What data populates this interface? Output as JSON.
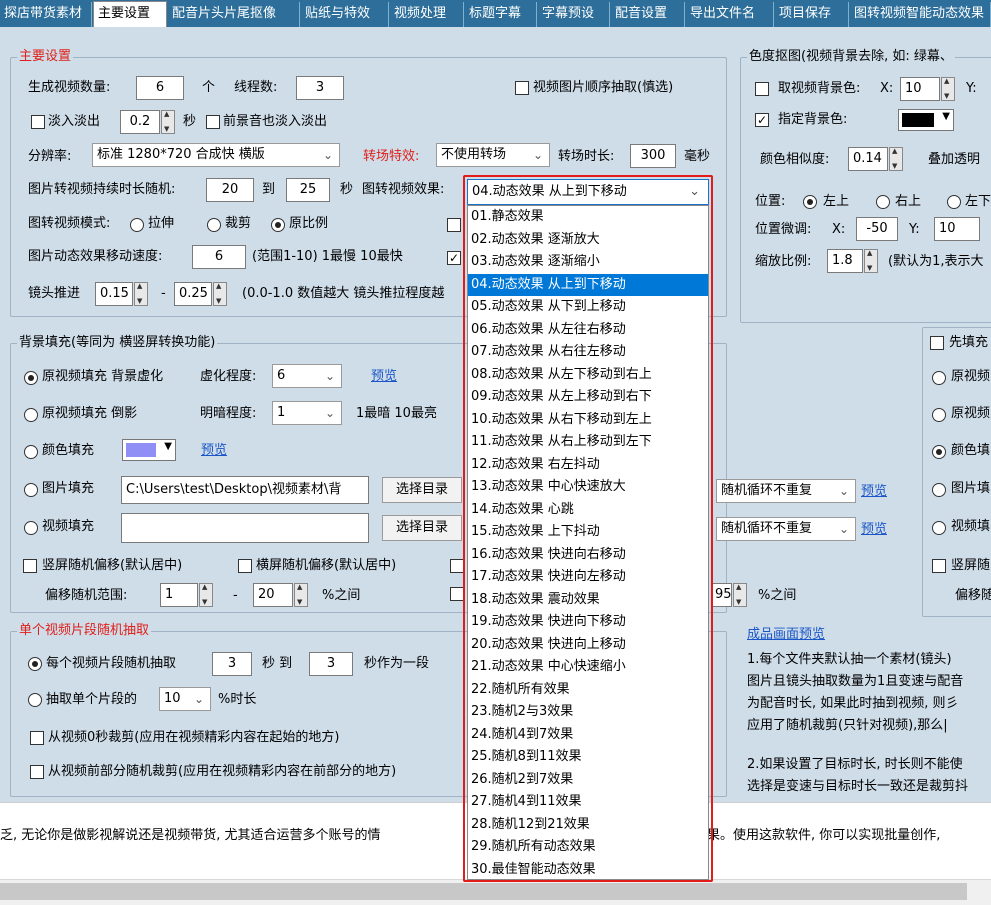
{
  "tabs": [
    "探店带货素材",
    "主要设置",
    "配音片头片尾抠像",
    "贴纸与特效",
    "视频处理",
    "标题字幕",
    "字幕预设",
    "配音设置",
    "导出文件名",
    "项目保存",
    "图转视频智能动态效果"
  ],
  "main": {
    "title": "主要设置",
    "count_label": "生成视频数量:",
    "count_value": "6",
    "count_unit": "个",
    "threads_label": "线程数:",
    "threads_value": "3",
    "seq_label": "视频图片顺序抽取(慎选)",
    "fade_label": "淡入淡出",
    "fade_value": "0.2",
    "fade_unit": "秒",
    "bgm_fade_label": "前景音也淡入淡出",
    "res_label": "分辨率:",
    "res_value": "标准 1280*720 合成快 横版",
    "trans_label": "转场特效:",
    "trans_value": "不使用转场",
    "trans_dur_label": "转场时长:",
    "trans_dur_value": "300",
    "trans_dur_unit": "毫秒",
    "img_dur_label": "图片转视频持续时长随机:",
    "img_dur_min": "20",
    "img_dur_to": "到",
    "img_dur_max": "25",
    "img_dur_unit": "秒",
    "img_effect_label": "图转视频效果:",
    "mode_label": "图转视频模式:",
    "mode_stretch": "拉伸",
    "mode_crop": "裁剪",
    "mode_ratio": "原比例",
    "speed_label": "图片动态效果移动速度:",
    "speed_value": "6",
    "speed_hint": "(范围1-10) 1最慢 10最快",
    "push_label": "镜头推进",
    "push_min": "0.15",
    "push_dash": "-",
    "push_max": "0.25",
    "push_hint": "(0.0-1.0 数值越大 镜头推拉程度越"
  },
  "effect_dropdown": {
    "selected": "04.动态效果 从上到下移动",
    "options": [
      "01.静态效果",
      "02.动态效果 逐渐放大",
      "03.动态效果 逐渐缩小",
      "04.动态效果 从上到下移动",
      "05.动态效果 从下到上移动",
      "06.动态效果 从左往右移动",
      "07.动态效果 从右往左移动",
      "08.动态效果 从左下移动到右上",
      "09.动态效果 从左上移动到右下",
      "10.动态效果 从右下移动到左上",
      "11.动态效果 从右上移动到左下",
      "12.动态效果 右左抖动",
      "13.动态效果 中心快速放大",
      "14.动态效果 心跳",
      "15.动态效果 上下抖动",
      "16.动态效果 快进向右移动",
      "17.动态效果 快进向左移动",
      "18.动态效果 震动效果",
      "19.动态效果 快进向下移动",
      "20.动态效果 快进向上移动",
      "21.动态效果 中心快速缩小",
      "22.随机所有效果",
      "23.随机2与3效果",
      "24.随机4到7效果",
      "25.随机8到11效果",
      "26.随机2到7效果",
      "27.随机4到11效果",
      "28.随机12到21效果",
      "29.随机所有动态效果",
      "30.最佳智能动态效果"
    ]
  },
  "chroma": {
    "title": "色度抠图(视频背景去除, 如: 绿幕、",
    "take_bg_label": "取视频背景色:",
    "x_label": "X:",
    "x_value": "10",
    "y_label": "Y:",
    "assign_label": "指定背景色:",
    "similar_label": "颜色相似度:",
    "similar_value": "0.14",
    "overlay_label": "叠加透明",
    "pos_label": "位置:",
    "pos_tl": "左上",
    "pos_tr": "右上",
    "pos_bl": "左下",
    "fine_label": "位置微调:",
    "fine_x_label": "X:",
    "fine_x": "-50",
    "fine_y_label": "Y:",
    "fine_y": "10",
    "scale_label": "缩放比例:",
    "scale_value": "1.8",
    "scale_hint": "(默认为1,表示大"
  },
  "bgfill": {
    "title": "背景填充(等同为 横竖屏转换功能)",
    "orig_blur": "原视频填充 背景虚化",
    "blur_label": "虚化程度:",
    "blur_value": "6",
    "preview": "预览",
    "orig_reflect": "原视频填充 倒影",
    "bright_label": "明暗程度:",
    "bright_value": "1",
    "bright_hint": "1最暗 10最亮",
    "color_fill": "颜色填充",
    "color_preview": "预览",
    "image_fill": "图片填充",
    "image_path": "C:\\Users\\test\\Desktop\\视频素材\\背",
    "choose_dir": "选择目录",
    "video_fill": "视频填充",
    "choose_dir2": "选择目录",
    "loop1": "随机循环不重复",
    "loop2": "随机循环不重复",
    "preview2": "预览",
    "preview3": "预览",
    "v_offset": "竖屏随机偏移(默认居中)",
    "h_offset": "横屏随机偏移(默认居中)",
    "range_label": "偏移随机范围:",
    "range_min": "1",
    "range_dash": "-",
    "range_max": "20",
    "range_unit": "%之间",
    "range_right_value": "95",
    "range_right_unit": "%之间"
  },
  "right_fill": {
    "prefill": "先填充",
    "o1": "原视频",
    "o2": "原视频",
    "o3": "颜色填",
    "o4": "图片填",
    "o5": "视频填",
    "o6": "竖屏随",
    "offset": "偏移随"
  },
  "segment": {
    "title": "单个视频片段随机抽取",
    "each_label": "每个视频片段随机抽取",
    "each_min": "3",
    "each_to": "秒 到",
    "each_max": "3",
    "each_unit": "秒作为一段",
    "single_label": "抽取单个片段的",
    "single_value": "10",
    "single_unit": "%时长",
    "from0": "从视频0秒裁剪(应用在视频精彩内容在起始的地方)",
    "from_front": "从视频前部分随机裁剪(应用在视频精彩内容在前部分的地方)"
  },
  "preview_panel": {
    "link": "成品画面预览",
    "l1": "1.每个文件夹默认抽一个素材(镜头)",
    "l2": "图片且镜头抽取数量为1且变速与配音",
    "l3": "为配音时长, 如果此时抽到视频, 则彡",
    "l4": "应用了随机裁剪(只针对视频),那么|",
    "l5": "2.如果设置了目标时长, 时长则不能使",
    "l6": "选择是变速与目标时长一致还是裁剪抖"
  },
  "bottom_text": "乏, 无论你是做影视解说还是视频带货, 尤其适合运营多个账号的情",
  "bottom_text2": "果。使用这款软件, 你可以实现批量创作,"
}
